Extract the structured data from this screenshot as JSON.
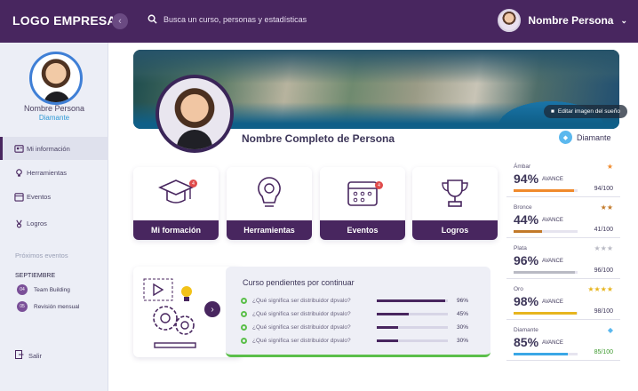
{
  "header": {
    "logo": "LOGO EMPRESA",
    "collapse_icon": "chevron-left-icon",
    "search_placeholder": "Busca un curso, personas y estadísticas",
    "user_name": "Nombre Persona"
  },
  "sidebar": {
    "name": "Nombre Persona",
    "tier": "Diamante",
    "items": [
      {
        "label": "Mi información",
        "icon": "profile-icon",
        "active": true
      },
      {
        "label": "Herramientas",
        "icon": "tools-icon",
        "active": false
      },
      {
        "label": "Eventos",
        "icon": "calendar-icon",
        "active": false
      },
      {
        "label": "Logros",
        "icon": "medal-icon",
        "active": false
      }
    ],
    "upcoming_title": "Próximos eventos",
    "month": "SEPTIEMBRE",
    "events": [
      {
        "day": "04",
        "label": "Team Building"
      },
      {
        "day": "05",
        "label": "Revisión mensual"
      }
    ],
    "exit": "Salir"
  },
  "profile": {
    "edit_label": "Editar imagen del sueño",
    "full_name": "Nombre Completo de Persona",
    "tier": "Diamante"
  },
  "cards": [
    {
      "label": "Mi formación",
      "icon": "graduation-cap-icon",
      "badge": true
    },
    {
      "label": "Herramientas",
      "icon": "lightbulb-gear-icon",
      "badge": false
    },
    {
      "label": "Eventos",
      "icon": "calendar-icon",
      "badge": true
    },
    {
      "label": "Logros",
      "icon": "trophy-icon",
      "badge": false
    }
  ],
  "pending": {
    "title": "Curso pendientes por continuar",
    "rows": [
      {
        "label": "¿Qué significa ser distribuidor dpvalo?",
        "pct": "96%",
        "value": 0.96
      },
      {
        "label": "¿Qué significa ser distribuidor dpvalo?",
        "pct": "45%",
        "value": 0.45
      },
      {
        "label": "¿Qué significa ser distribuidor dpvalo?",
        "pct": "30%",
        "value": 0.3
      },
      {
        "label": "¿Qué significa ser distribuidor dpvalo?",
        "pct": "30%",
        "value": 0.3
      }
    ]
  },
  "levels": [
    {
      "name": "Ámbar",
      "pct": "94%",
      "unit": "AVANCE",
      "score": "94/100",
      "value": 0.94,
      "stars": "★",
      "color": "#f08a2c",
      "star_color": "#f08a2c",
      "score_color": "#3c3558"
    },
    {
      "name": "Bronce",
      "pct": "44%",
      "unit": "AVANCE",
      "score": "41/100",
      "value": 0.44,
      "stars": "★★",
      "color": "#c27a2a",
      "star_color": "#c27a2a",
      "score_color": "#3c3558"
    },
    {
      "name": "Plata",
      "pct": "96%",
      "unit": "AVANCE",
      "score": "96/100",
      "value": 0.96,
      "stars": "★★★",
      "color": "#b9bac4",
      "star_color": "#b9bac4",
      "score_color": "#3c3558"
    },
    {
      "name": "Oro",
      "pct": "98%",
      "unit": "AVANCE",
      "score": "98/100",
      "value": 0.98,
      "stars": "★★★★",
      "color": "#e7b51f",
      "star_color": "#e7b51f",
      "score_color": "#3c3558"
    },
    {
      "name": "Diamante",
      "pct": "85%",
      "unit": "AVANCE",
      "score": "85/100",
      "value": 0.85,
      "stars": "◆",
      "color": "#3aa7e6",
      "star_color": "#5bb8ee",
      "score_color": "#3d9a2e"
    }
  ]
}
